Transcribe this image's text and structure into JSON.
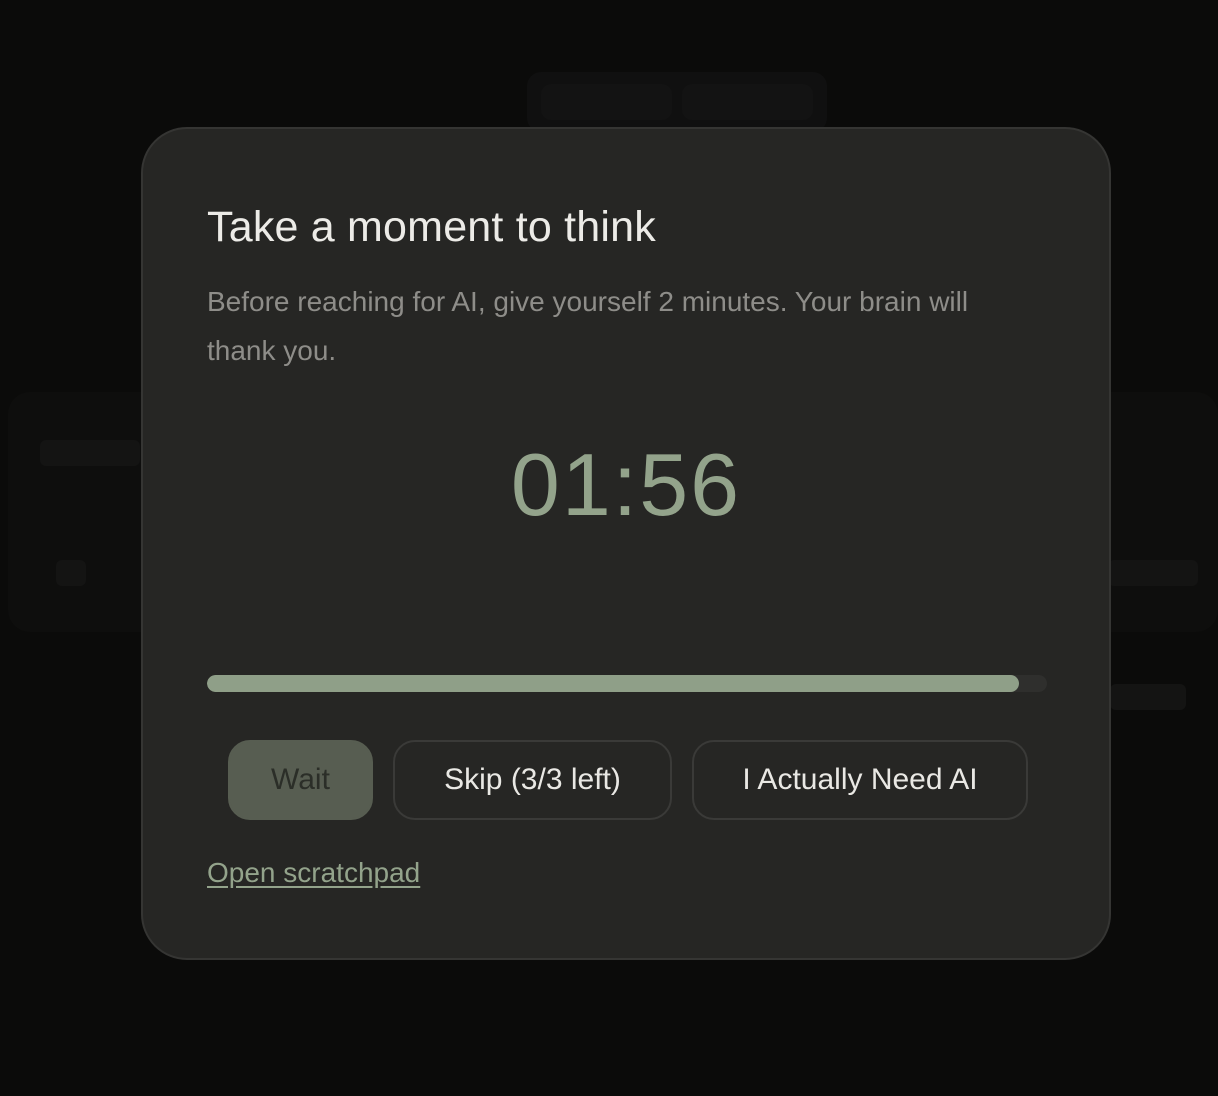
{
  "modal": {
    "title": "Take a moment to think",
    "subtitle": "Before reaching for AI, give yourself 2 minutes. Your brain will thank you.",
    "timer": "01:56",
    "progress_fraction": 0.967,
    "buttons": {
      "wait_label": "Wait",
      "skip_label": "Skip (3/3 left)",
      "need_ai_label": "I Actually Need AI"
    },
    "scratchpad_link": "Open scratchpad"
  },
  "colors": {
    "accent": "#93a38b",
    "modal_bg": "#262624",
    "backdrop": "#0b0b0a"
  }
}
